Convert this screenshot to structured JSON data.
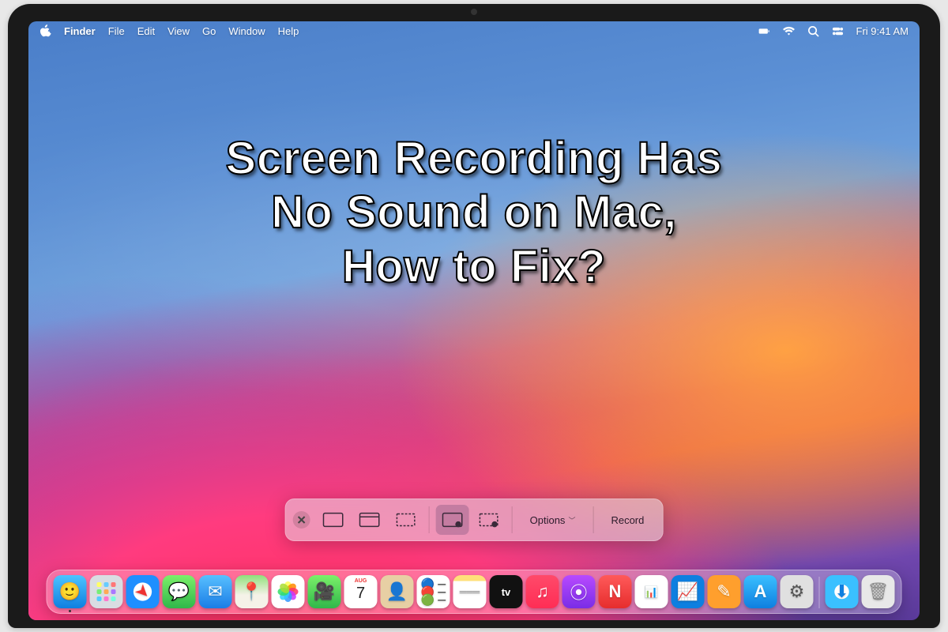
{
  "menubar": {
    "app": "Finder",
    "items": [
      "File",
      "Edit",
      "View",
      "Go",
      "Window",
      "Help"
    ],
    "clock": "Fri 9:41 AM"
  },
  "headline": {
    "line1": "Screen Recording Has",
    "line2": "No Sound on Mac,",
    "line3": "How to Fix?"
  },
  "screenshot_toolbar": {
    "options_label": "Options",
    "record_label": "Record",
    "modes": [
      {
        "id": "capture-entire",
        "name": "capture-entire-screen-icon"
      },
      {
        "id": "capture-window",
        "name": "capture-window-icon"
      },
      {
        "id": "capture-selection",
        "name": "capture-selection-icon"
      },
      {
        "id": "record-entire",
        "name": "record-entire-screen-icon",
        "selected": true
      },
      {
        "id": "record-selection",
        "name": "record-selection-icon"
      }
    ]
  },
  "calendar": {
    "month": "AUG",
    "day": "7"
  },
  "dock": [
    {
      "name": "finder-app-icon"
    },
    {
      "name": "launchpad-app-icon"
    },
    {
      "name": "safari-app-icon"
    },
    {
      "name": "messages-app-icon"
    },
    {
      "name": "mail-app-icon"
    },
    {
      "name": "maps-app-icon"
    },
    {
      "name": "photos-app-icon"
    },
    {
      "name": "facetime-app-icon"
    },
    {
      "name": "calendar-app-icon"
    },
    {
      "name": "contacts-app-icon"
    },
    {
      "name": "reminders-app-icon"
    },
    {
      "name": "notes-app-icon"
    },
    {
      "name": "tv-app-icon"
    },
    {
      "name": "music-app-icon"
    },
    {
      "name": "podcasts-app-icon"
    },
    {
      "name": "news-app-icon"
    },
    {
      "name": "numbers-app-icon"
    },
    {
      "name": "keynote-app-icon"
    },
    {
      "name": "pages-app-icon"
    },
    {
      "name": "appstore-app-icon"
    },
    {
      "name": "system-preferences-app-icon"
    },
    {
      "name": "downloads-stack-icon"
    },
    {
      "name": "trash-icon"
    }
  ]
}
